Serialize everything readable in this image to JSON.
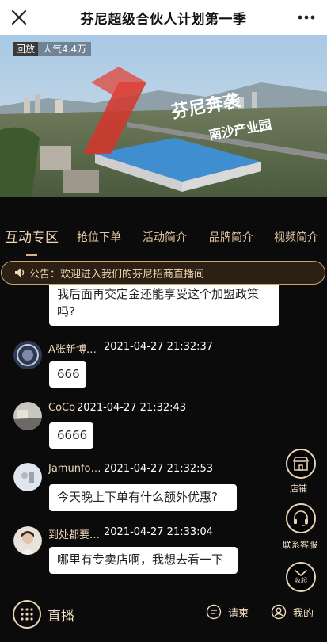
{
  "header": {
    "title": "芬尼超级合伙人计划第一季",
    "close_icon": "close-icon",
    "more_icon": "more-icon"
  },
  "video": {
    "replay_label": "回放",
    "popularity": "人气4.4万",
    "overlay_title": "芬尼奔袭",
    "overlay_subtitle": "南沙产业园"
  },
  "tabs": [
    {
      "label": "互动专区",
      "active": true
    },
    {
      "label": "抢位下单"
    },
    {
      "label": "活动简介"
    },
    {
      "label": "品牌简介"
    },
    {
      "label": "视频简介"
    }
  ],
  "notice": {
    "text": "公告：欢迎进入我们的芬尼招商直播间"
  },
  "messages": [
    {
      "name": "",
      "time": "",
      "text": "我后面再交定金还能享受这个加盟政策吗?"
    },
    {
      "name": "A张新博…",
      "time": "2021-04-27 21:32:37",
      "text": "666"
    },
    {
      "name": "CoCo",
      "time": "2021-04-27 21:32:43",
      "text": "6666"
    },
    {
      "name": "Jamunfo…",
      "time": "2021-04-27 21:32:53",
      "text": "今天晚上下单有什么额外优惠?"
    },
    {
      "name": "到处都要…",
      "time": "2021-04-27 21:33:04",
      "text": "哪里有专卖店啊，我想去看一下"
    }
  ],
  "float_buttons": {
    "shop": "店铺",
    "service": "联系客服",
    "collapse": "收起"
  },
  "bottom": {
    "live_label": "直播",
    "request_label": "请柬",
    "mine_label": "我的"
  },
  "colors": {
    "accent": "#e7c9a1",
    "background": "#0b0b0b",
    "notice_border": "#c9a46e"
  }
}
